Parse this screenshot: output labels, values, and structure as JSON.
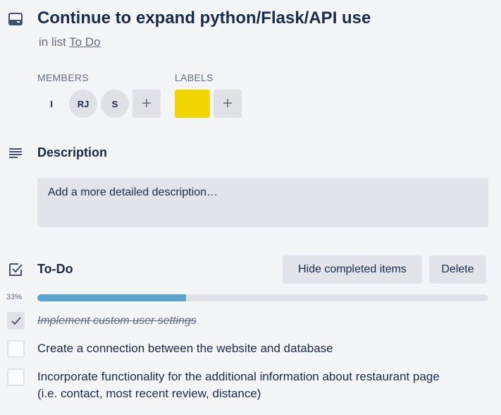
{
  "card": {
    "title": "Continue to expand python/Flask/API use",
    "in_list_prefix": "in list",
    "list_name": "To Do",
    "icon": "card-icon"
  },
  "members": {
    "label": "MEMBERS",
    "avatars": [
      "I",
      "RJ",
      "S"
    ],
    "add_symbol": "+"
  },
  "labels": {
    "label": "LABELS",
    "chips": [
      {
        "color": "#f2d600"
      }
    ],
    "add_symbol": "+"
  },
  "description": {
    "heading": "Description",
    "placeholder": "Add a more detailed description…",
    "icon": "description-icon"
  },
  "checklist": {
    "title": "To-Do",
    "hide_completed_label": "Hide completed items",
    "delete_label": "Delete",
    "progress_label": "33%",
    "progress": 0.33,
    "icon": "checklist-icon",
    "items": [
      {
        "text": "Implement custom user settings",
        "checked": true
      },
      {
        "text": "Create a connection between the website and database",
        "checked": false
      },
      {
        "text": "Incorporate functionality for the additional information about restaurant page",
        "text2": "(i.e. contact, most recent review, distance)",
        "checked": false
      }
    ]
  },
  "colors": {
    "accent": "#5ba4cf",
    "label_yellow": "#f2d600",
    "background": "#f4f5f7"
  }
}
